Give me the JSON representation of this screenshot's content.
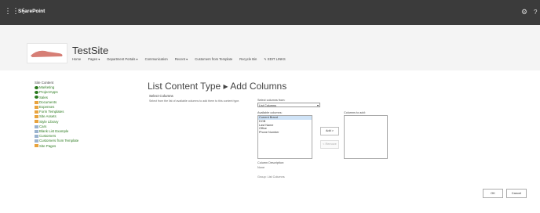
{
  "suitebar": {
    "app_name": "SharePoint",
    "waffle_icon": "waffle-icon",
    "settings_icon": "gear-icon",
    "help_icon": "help-icon",
    "help_glyph": "?"
  },
  "site": {
    "title": "TestSite"
  },
  "topnav": [
    "Home",
    "Pages ▾",
    "Department Portals ▾",
    "Communication",
    "Recent ▾",
    "Customers from Template",
    "Recycle Bin",
    "✎ EDIT LINKS"
  ],
  "tree": {
    "heading": "Site Content",
    "items": [
      {
        "label": "Marketing",
        "icon": "site"
      },
      {
        "label": "ProjectApps",
        "icon": "site"
      },
      {
        "label": "Sales",
        "icon": "site"
      },
      {
        "label": "Documents",
        "icon": "lib"
      },
      {
        "label": "Expenses",
        "icon": "lib"
      },
      {
        "label": "Form Templates",
        "icon": "lib"
      },
      {
        "label": "Site Assets",
        "icon": "lib"
      },
      {
        "label": "Style Library",
        "icon": "lib"
      },
      {
        "label": "Cars",
        "icon": "list"
      },
      {
        "label": "Blank List Example",
        "icon": "list"
      },
      {
        "label": "Customers",
        "icon": "list"
      },
      {
        "label": "Customers from Template",
        "icon": "list"
      },
      {
        "label": "Site Pages",
        "icon": "lib"
      }
    ]
  },
  "main": {
    "title": "List Content Type ▸ Add Columns",
    "section_label": "Select Columns",
    "section_desc": "Select from the list of available columns to add them to this content type.",
    "select_from_label": "Select columns from:",
    "select_from_value": "List Columns",
    "available_label": "Available columns:",
    "available_columns": [
      "Current Brand",
      "DOB",
      "Last Name",
      "Office",
      "Phone Number"
    ],
    "selected_index": 0,
    "add_button": "Add >",
    "remove_button": "< Remove",
    "columns_to_add_label": "Columns to add:",
    "column_desc_label": "Column Description:",
    "column_desc_value": "None",
    "group_label": "Group: List Columns"
  },
  "footer": {
    "ok": "OK",
    "cancel": "Cancel"
  }
}
